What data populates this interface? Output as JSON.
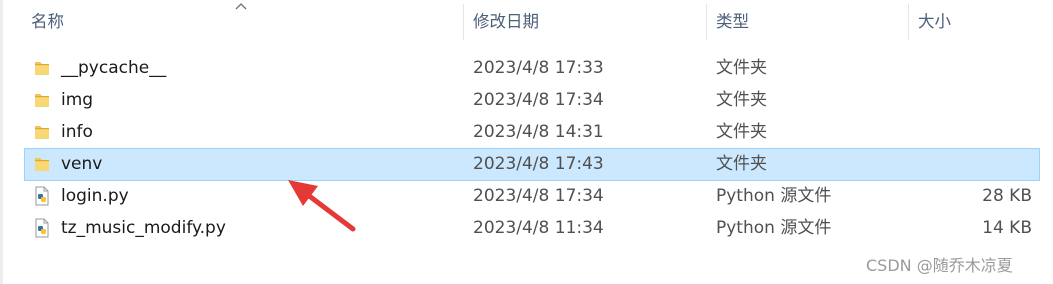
{
  "columns": {
    "name": "名称",
    "modified": "修改日期",
    "type": "类型",
    "size": "大小"
  },
  "sort": {
    "column": "name",
    "icon": "sort-up-caret-icon"
  },
  "files": [
    {
      "name": "__pycache__",
      "modified": "2023/4/8 17:33",
      "type": "文件夹",
      "size": "",
      "icon": "folder-icon",
      "selected": false
    },
    {
      "name": "img",
      "modified": "2023/4/8 17:34",
      "type": "文件夹",
      "size": "",
      "icon": "folder-icon",
      "selected": false
    },
    {
      "name": "info",
      "modified": "2023/4/8 14:31",
      "type": "文件夹",
      "size": "",
      "icon": "folder-icon",
      "selected": false
    },
    {
      "name": "venv",
      "modified": "2023/4/8 17:43",
      "type": "文件夹",
      "size": "",
      "icon": "folder-icon",
      "selected": true
    },
    {
      "name": "login.py",
      "modified": "2023/4/8 17:34",
      "type": "Python 源文件",
      "size": "28 KB",
      "icon": "python-file-icon",
      "selected": false
    },
    {
      "name": "tz_music_modify.py",
      "modified": "2023/4/8 11:34",
      "type": "Python 源文件",
      "size": "14 KB",
      "icon": "python-file-icon",
      "selected": false
    }
  ],
  "annotation": {
    "icon": "red-arrow-icon",
    "color": "#e53935"
  },
  "watermark": "CSDN @随乔木凉夏",
  "colors": {
    "selection_bg": "#cce8ff",
    "selection_border": "#99d1ff",
    "header_text": "#4c607a",
    "folder": "#f5c451",
    "python_blue": "#3572a5"
  }
}
